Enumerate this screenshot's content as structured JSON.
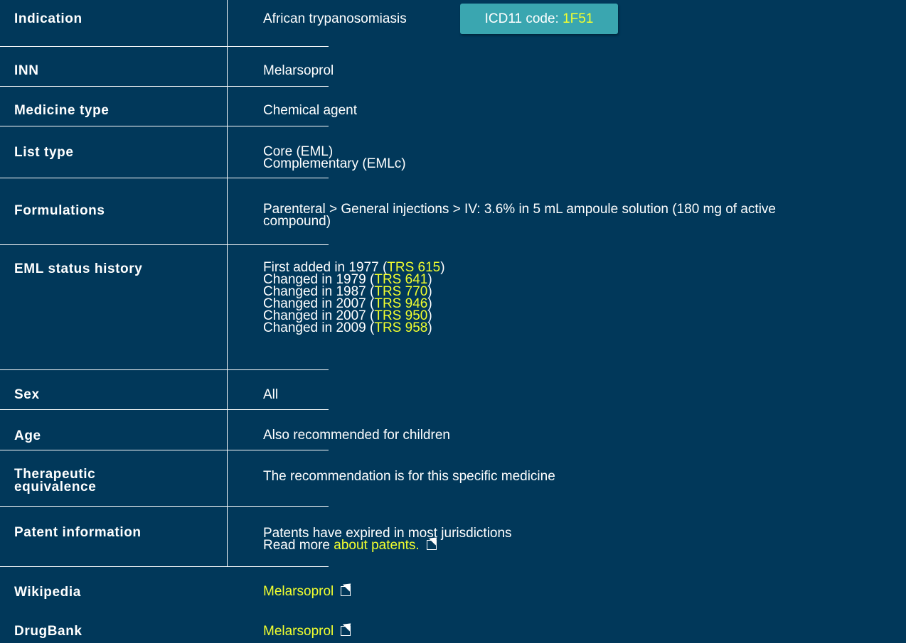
{
  "indication": {
    "label": "Indication",
    "value": "African trypanosomiasis",
    "icd_badge": {
      "prefix": "ICD11 code:",
      "code": "1F51"
    }
  },
  "inn": {
    "label": "INN",
    "value": "Melarsoprol"
  },
  "medicine_type": {
    "label": "Medicine type",
    "value": "Chemical agent"
  },
  "list_type": {
    "label": "List type",
    "values": [
      "Core (EML)",
      "Complementary (EMLc)"
    ]
  },
  "formulations": {
    "label": "Formulations",
    "lines": [
      "Parenteral > General injections > IV: 3.6% in 5 mL ampoule solution (180 mg of active",
      "compound)"
    ]
  },
  "eml_status_history": {
    "label": "EML status history",
    "entries": [
      {
        "text": "First added in 1977 (",
        "link": "TRS 615",
        "close": ")"
      },
      {
        "text": "Changed in 1979 (",
        "link": "TRS 641",
        "close": ")"
      },
      {
        "text": "Changed in 1987 (",
        "link": "TRS 770",
        "close": ")"
      },
      {
        "text": "Changed in 2007 (",
        "link": "TRS 946",
        "close": ")"
      },
      {
        "text": "Changed in 2007 (",
        "link": "TRS 950",
        "close": ")"
      },
      {
        "text": "Changed in 2009 (",
        "link": "TRS 958",
        "close": ")"
      }
    ]
  },
  "sex": {
    "label": "Sex",
    "value": "All"
  },
  "age": {
    "label": "Age",
    "value": "Also recommended for children"
  },
  "therapeutic_equivalence": {
    "label_lines": [
      "Therapeutic",
      "equivalence"
    ],
    "value": "The recommendation is for this specific medicine"
  },
  "patent_information": {
    "label": "Patent information",
    "value": "Patents have expired in most jurisdictions",
    "read_more": "Read more",
    "link": "about patents."
  },
  "wikipedia": {
    "label": "Wikipedia",
    "link": "Melarsoprol"
  },
  "drugbank": {
    "label": "DrugBank",
    "link": "Melarsoprol"
  },
  "colors": {
    "background": "#01385a",
    "link": "#f2ff2e",
    "badge": "#3aa6b0",
    "text": "#ffffff"
  },
  "icons": {
    "external_link": "external-link-icon"
  }
}
